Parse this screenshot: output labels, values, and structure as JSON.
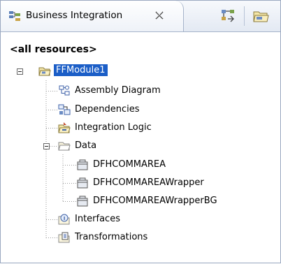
{
  "view": {
    "tab_title": "Business Integration",
    "tab_icon": "business-integration-icon",
    "close_icon": "close-icon",
    "toolbar": [
      {
        "name": "view-menu-button",
        "icon": "filter-icon"
      },
      {
        "name": "new-module-button",
        "icon": "folder-icon"
      }
    ]
  },
  "filter_label": "<all resources>",
  "tree": {
    "module": {
      "label": "FFModule1",
      "icon": "module-icon",
      "expanded": true,
      "selected": true
    },
    "children": [
      {
        "label": "Assembly Diagram",
        "icon": "assembly-diagram-icon"
      },
      {
        "label": "Dependencies",
        "icon": "dependencies-icon"
      },
      {
        "label": "Integration Logic",
        "icon": "integration-logic-icon"
      },
      {
        "label": "Data",
        "icon": "data-folder-icon",
        "expanded": true,
        "children": [
          {
            "label": "DFHCOMMAREA",
            "icon": "business-object-icon"
          },
          {
            "label": "DFHCOMMAREAWrapper",
            "icon": "business-object-icon"
          },
          {
            "label": "DFHCOMMAREAWrapperBG",
            "icon": "business-object-icon"
          }
        ]
      },
      {
        "label": "Interfaces",
        "icon": "interfaces-icon"
      },
      {
        "label": "Transformations",
        "icon": "transformations-icon"
      }
    ]
  },
  "colors": {
    "selection": "#1b5ec7",
    "border": "#9aa8c0",
    "tree_line": "#9a9a9a"
  }
}
